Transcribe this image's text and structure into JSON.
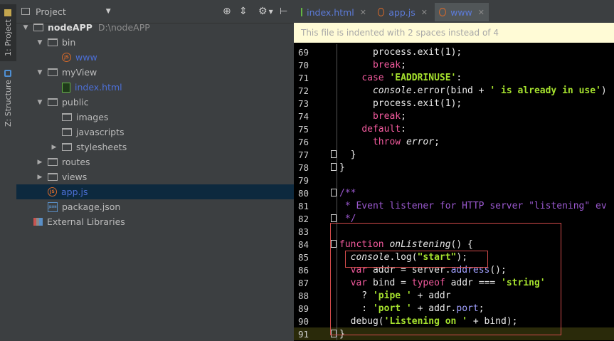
{
  "strip": {
    "project_tab": "1: Project",
    "structure_tab": "Z: Structure"
  },
  "project_panel": {
    "title": "Project",
    "tree": [
      {
        "label": "nodeAPP",
        "detail": "D:\\nodeAPP",
        "type": "folder",
        "depth": 0,
        "expanded": true
      },
      {
        "label": "bin",
        "type": "folder",
        "depth": 1,
        "expanded": true
      },
      {
        "label": "www",
        "type": "js-file",
        "depth": 2
      },
      {
        "label": "myView",
        "type": "folder",
        "depth": 1,
        "expanded": true
      },
      {
        "label": "index.html",
        "type": "html-file",
        "depth": 2
      },
      {
        "label": "public",
        "type": "folder",
        "depth": 1,
        "expanded": true
      },
      {
        "label": "images",
        "type": "folder",
        "depth": 2
      },
      {
        "label": "javascripts",
        "type": "folder",
        "depth": 2
      },
      {
        "label": "stylesheets",
        "type": "folder",
        "depth": 2,
        "collapsed": true
      },
      {
        "label": "routes",
        "type": "folder",
        "depth": 1,
        "collapsed": true
      },
      {
        "label": "views",
        "type": "folder",
        "depth": 1,
        "collapsed": true
      },
      {
        "label": "app.js",
        "type": "js-file",
        "depth": 1,
        "selected": true
      },
      {
        "label": "package.json",
        "type": "json-file",
        "depth": 1
      },
      {
        "label": "External Libraries",
        "type": "library",
        "depth": 0
      }
    ]
  },
  "editor": {
    "tabs": [
      {
        "label": "index.html",
        "icon": "html-file-icon"
      },
      {
        "label": "app.js",
        "icon": "js-file-icon"
      },
      {
        "label": "www",
        "icon": "js-file-icon",
        "active": true
      }
    ],
    "notice": "This file is indented with 2 spaces instead of 4",
    "lines": [
      {
        "n": "69",
        "code": [
          [
            "      ",
            "txt"
          ],
          [
            "process",
            "mth"
          ],
          [
            ".exit(",
            "txt"
          ],
          [
            "1",
            "txt"
          ],
          [
            ");",
            "txt"
          ]
        ]
      },
      {
        "n": "70",
        "code": [
          [
            "      ",
            "txt"
          ],
          [
            "break",
            "kw"
          ],
          [
            ";",
            "txt"
          ]
        ]
      },
      {
        "n": "71",
        "code": [
          [
            "    ",
            "txt"
          ],
          [
            "case ",
            "kw"
          ],
          [
            "'EADDRINUSE'",
            "str"
          ],
          [
            ":",
            "txt"
          ]
        ]
      },
      {
        "n": "72",
        "code": [
          [
            "      ",
            "txt"
          ],
          [
            "console",
            "fn"
          ],
          [
            ".error(bind + ",
            "txt"
          ],
          [
            "' is already in use'",
            "str"
          ],
          [
            ")",
            "txt"
          ]
        ]
      },
      {
        "n": "73",
        "code": [
          [
            "      ",
            "txt"
          ],
          [
            "process",
            "mth"
          ],
          [
            ".exit(",
            "txt"
          ],
          [
            "1",
            "txt"
          ],
          [
            ");",
            "txt"
          ]
        ]
      },
      {
        "n": "74",
        "code": [
          [
            "      ",
            "txt"
          ],
          [
            "break",
            "kw"
          ],
          [
            ";",
            "txt"
          ]
        ]
      },
      {
        "n": "75",
        "code": [
          [
            "    ",
            "txt"
          ],
          [
            "default",
            "kw"
          ],
          [
            ":",
            "txt"
          ]
        ]
      },
      {
        "n": "76",
        "code": [
          [
            "      ",
            "txt"
          ],
          [
            "throw ",
            "kw"
          ],
          [
            "error",
            "fn"
          ],
          [
            ";",
            "txt"
          ]
        ]
      },
      {
        "n": "77",
        "fold": true,
        "code": [
          [
            "  }",
            "txt"
          ]
        ]
      },
      {
        "n": "78",
        "fold": true,
        "code": [
          [
            "}",
            "txt"
          ]
        ]
      },
      {
        "n": "79",
        "code": []
      },
      {
        "n": "80",
        "fold": true,
        "code": [
          [
            "/**",
            "cm"
          ]
        ]
      },
      {
        "n": "81",
        "code": [
          [
            " * Event listener for HTTP server \"listening\" ev",
            "cm"
          ]
        ]
      },
      {
        "n": "82",
        "fold": true,
        "code": [
          [
            " */",
            "cm"
          ]
        ]
      },
      {
        "n": "83",
        "code": []
      },
      {
        "n": "84",
        "fold": true,
        "code": [
          [
            "function ",
            "kw"
          ],
          [
            "onListening",
            "fn"
          ],
          [
            "() {",
            "txt"
          ]
        ]
      },
      {
        "n": "85",
        "code": [
          [
            "  ",
            "txt"
          ],
          [
            "console",
            "fn"
          ],
          [
            ".log(",
            "txt"
          ],
          [
            "\"start\"",
            "str"
          ],
          [
            ");",
            "txt"
          ]
        ]
      },
      {
        "n": "86",
        "code": [
          [
            "  ",
            "txt"
          ],
          [
            "var ",
            "kw"
          ],
          [
            "addr",
            "txt"
          ],
          [
            " = server.",
            "txt"
          ],
          [
            "address",
            "fld"
          ],
          [
            "();",
            "txt"
          ]
        ]
      },
      {
        "n": "87",
        "code": [
          [
            "  ",
            "txt"
          ],
          [
            "var ",
            "kw"
          ],
          [
            "bind = ",
            "txt"
          ],
          [
            "typeof ",
            "kw"
          ],
          [
            "addr === ",
            "txt"
          ],
          [
            "'string'",
            "str"
          ]
        ]
      },
      {
        "n": "88",
        "code": [
          [
            "    ? ",
            "txt"
          ],
          [
            "'pipe '",
            "str"
          ],
          [
            " + addr",
            "txt"
          ]
        ]
      },
      {
        "n": "89",
        "code": [
          [
            "    : ",
            "txt"
          ],
          [
            "'port '",
            "str"
          ],
          [
            " + addr.",
            "txt"
          ],
          [
            "port",
            "fld"
          ],
          [
            ";",
            "txt"
          ]
        ]
      },
      {
        "n": "90",
        "code": [
          [
            "  debug(",
            "txt"
          ],
          [
            "'Listening on '",
            "str"
          ],
          [
            " + bind);",
            "txt"
          ]
        ]
      },
      {
        "n": "91",
        "fold": true,
        "current": true,
        "code": [
          [
            "}",
            "txt"
          ]
        ]
      }
    ]
  },
  "colors": {
    "selection": "#0d293e",
    "annotation_box": "#d24b4b",
    "notice_bg": "#fffbd6"
  }
}
